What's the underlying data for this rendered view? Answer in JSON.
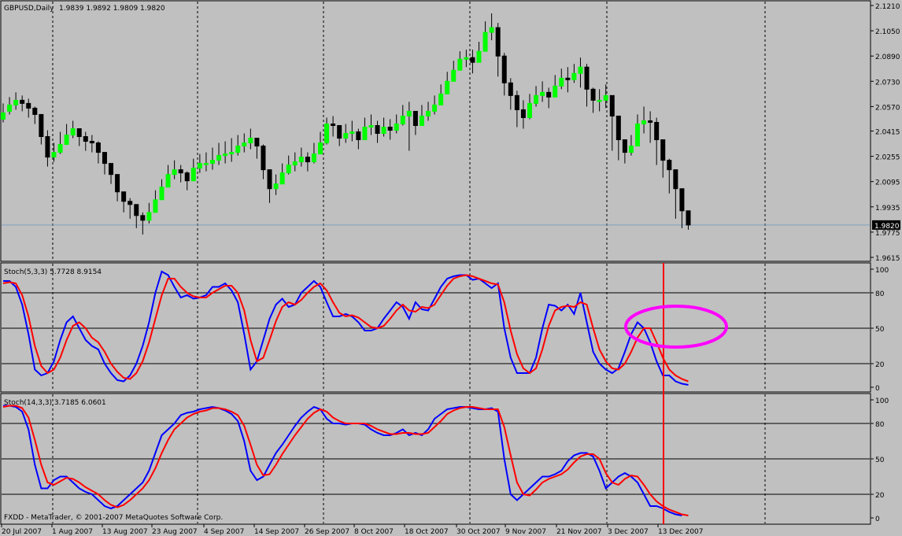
{
  "colors": {
    "background": "#c0c0c0",
    "bull_candle": "#00ff00",
    "bear_candle": "#000000",
    "stoch_main": "#0000ff",
    "stoch_signal": "#ff0000",
    "marker_line": "#ff0000",
    "highlight_ellipse": "#ff00ff",
    "price_line": "#7f9fbf"
  },
  "header": {
    "title": "GBPUSD,Daily",
    "ohlc": "1.9839 1.9892 1.9809 1.9820",
    "stoch1": "Stoch(5,3,3) 5.7728 8.9154",
    "stoch2": "Stoch(14,3,3) 3.7185 6.0601",
    "footer": "FXDD - MetaTrader, © 2001-2007 MetaQuotes Software Corp."
  },
  "chart_data": [
    {
      "type": "candlestick",
      "title": "GBPUSD,Daily",
      "ylim": [
        1.9615,
        2.121
      ],
      "y_ticks": [
        "2.1210",
        "2.1050",
        "2.0890",
        "2.0730",
        "2.0570",
        "2.0415",
        "2.0255",
        "2.0095",
        "1.9935",
        "1.9775",
        "1.9615"
      ],
      "current_price": "1.9820",
      "x_ticks": [
        "20 Jul 2007",
        "1 Aug 2007",
        "13 Aug 2007",
        "23 Aug 2007",
        "4 Sep 2007",
        "14 Sep 2007",
        "26 Sep 2007",
        "8 Oct 2007",
        "18 Oct 2007",
        "30 Oct 2007",
        "9 Nov 2007",
        "21 Nov 2007",
        "3 Dec 2007",
        "13 Dec 2007"
      ],
      "close": [
        2.053,
        2.058,
        2.061,
        2.059,
        2.056,
        2.052,
        2.038,
        2.025,
        2.028,
        2.033,
        2.039,
        2.043,
        2.038,
        2.035,
        2.034,
        2.028,
        2.021,
        2.014,
        2.003,
        1.997,
        1.995,
        1.988,
        1.985,
        1.99,
        1.998,
        2.006,
        2.014,
        2.017,
        2.015,
        2.01,
        2.018,
        2.021,
        2.021,
        2.023,
        2.026,
        2.027,
        2.028,
        2.032,
        2.034,
        2.037,
        2.032,
        2.017,
        2.005,
        2.008,
        2.015,
        2.02,
        2.022,
        2.025,
        2.022,
        2.027,
        2.034,
        2.046,
        2.045,
        2.037,
        2.04,
        2.041,
        2.036,
        2.044,
        2.045,
        2.04,
        2.044,
        2.042,
        2.046,
        2.051,
        2.054,
        2.045,
        2.051,
        2.054,
        2.058,
        2.065,
        2.073,
        2.08,
        2.087,
        2.088,
        2.085,
        2.092,
        2.104,
        2.107,
        2.089,
        2.072,
        2.064,
        2.055,
        2.05,
        2.059,
        2.064,
        2.066,
        2.063,
        2.07,
        2.075,
        2.074,
        2.078,
        2.082,
        2.068,
        2.061,
        2.061,
        2.064,
        2.051,
        2.036,
        2.028,
        2.032,
        2.046,
        2.048,
        2.047,
        2.036,
        2.023,
        2.017,
        2.005,
        1.991,
        1.982
      ],
      "high": [
        2.059,
        2.063,
        2.066,
        2.064,
        2.062,
        2.057,
        2.052,
        2.042,
        2.034,
        2.041,
        2.046,
        2.048,
        2.043,
        2.041,
        2.039,
        2.035,
        2.028,
        2.021,
        2.01,
        2.002,
        1.999,
        1.994,
        1.99,
        1.996,
        2.004,
        2.011,
        2.02,
        2.023,
        2.02,
        2.016,
        2.024,
        2.027,
        2.028,
        2.031,
        2.034,
        2.035,
        2.037,
        2.039,
        2.04,
        2.043,
        2.037,
        2.033,
        2.015,
        2.014,
        2.021,
        2.026,
        2.028,
        2.031,
        2.028,
        2.034,
        2.041,
        2.05,
        2.051,
        2.045,
        2.046,
        2.048,
        2.043,
        2.05,
        2.052,
        2.048,
        2.05,
        2.049,
        2.052,
        2.058,
        2.06,
        2.052,
        2.058,
        2.06,
        2.064,
        2.071,
        2.079,
        2.086,
        2.092,
        2.093,
        2.093,
        2.098,
        2.111,
        2.116,
        2.11,
        2.091,
        2.075,
        2.067,
        2.061,
        2.065,
        2.07,
        2.073,
        2.069,
        2.077,
        2.081,
        2.082,
        2.084,
        2.088,
        2.084,
        2.069,
        2.068,
        2.071,
        2.064,
        2.05,
        2.035,
        2.039,
        2.052,
        2.057,
        2.054,
        2.05,
        2.03,
        2.024,
        2.017,
        1.998,
        1.989
      ],
      "low": [
        2.047,
        2.052,
        2.055,
        2.054,
        2.05,
        2.046,
        2.033,
        2.019,
        2.022,
        2.027,
        2.033,
        2.037,
        2.032,
        2.029,
        2.028,
        2.021,
        2.014,
        2.008,
        1.997,
        1.99,
        1.986,
        1.98,
        1.976,
        1.983,
        1.991,
        1.999,
        2.007,
        2.011,
        2.009,
        2.004,
        2.011,
        2.015,
        2.016,
        2.017,
        2.02,
        2.021,
        2.022,
        2.026,
        2.028,
        2.03,
        2.024,
        2.011,
        1.996,
        2.001,
        2.009,
        2.014,
        2.016,
        2.019,
        2.016,
        2.021,
        2.027,
        2.033,
        2.038,
        2.032,
        2.034,
        2.035,
        2.03,
        2.037,
        2.039,
        2.034,
        2.038,
        2.036,
        2.04,
        2.045,
        2.029,
        2.039,
        2.045,
        2.048,
        2.052,
        2.058,
        2.066,
        2.073,
        2.08,
        2.082,
        2.078,
        2.085,
        2.097,
        2.099,
        2.076,
        2.064,
        2.055,
        2.044,
        2.043,
        2.049,
        2.057,
        2.06,
        2.056,
        2.063,
        2.068,
        2.066,
        2.072,
        2.069,
        2.057,
        2.053,
        2.054,
        2.056,
        2.029,
        2.023,
        2.021,
        2.026,
        2.039,
        2.04,
        2.034,
        2.02,
        2.012,
        2.002,
        1.986,
        1.98,
        1.979
      ],
      "open": [
        2.049,
        2.054,
        2.058,
        2.061,
        2.059,
        2.056,
        2.052,
        2.038,
        2.025,
        2.028,
        2.033,
        2.039,
        2.043,
        2.038,
        2.035,
        2.034,
        2.028,
        2.021,
        2.014,
        2.003,
        1.997,
        1.995,
        1.988,
        1.985,
        1.99,
        1.998,
        2.006,
        2.014,
        2.017,
        2.015,
        2.01,
        2.018,
        2.021,
        2.021,
        2.023,
        2.026,
        2.027,
        2.028,
        2.032,
        2.034,
        2.037,
        2.032,
        2.017,
        2.005,
        2.008,
        2.015,
        2.02,
        2.022,
        2.025,
        2.022,
        2.027,
        2.034,
        2.046,
        2.045,
        2.037,
        2.04,
        2.041,
        2.036,
        2.044,
        2.045,
        2.04,
        2.044,
        2.042,
        2.046,
        2.051,
        2.054,
        2.045,
        2.051,
        2.054,
        2.058,
        2.065,
        2.073,
        2.08,
        2.087,
        2.088,
        2.085,
        2.092,
        2.104,
        2.107,
        2.089,
        2.072,
        2.064,
        2.055,
        2.05,
        2.059,
        2.064,
        2.066,
        2.063,
        2.07,
        2.075,
        2.074,
        2.078,
        2.082,
        2.068,
        2.061,
        2.061,
        2.064,
        2.051,
        2.036,
        2.028,
        2.032,
        2.046,
        2.048,
        2.047,
        2.036,
        2.023,
        2.017,
        2.005,
        1.991
      ]
    },
    {
      "type": "line",
      "title": "Stoch(5,3,3) 5.7728 8.9154",
      "ylim": [
        0,
        100
      ],
      "y_ticks": [
        "100",
        "80",
        "50",
        "20",
        "0"
      ],
      "series": [
        {
          "name": "main",
          "values": [
            90,
            90,
            85,
            70,
            45,
            15,
            10,
            12,
            22,
            40,
            55,
            60,
            50,
            40,
            35,
            32,
            20,
            12,
            6,
            5,
            10,
            20,
            35,
            55,
            80,
            98,
            95,
            85,
            76,
            78,
            75,
            76,
            78,
            85,
            85,
            88,
            82,
            72,
            45,
            15,
            22,
            40,
            58,
            70,
            75,
            68,
            70,
            80,
            85,
            90,
            85,
            72,
            60,
            60,
            62,
            60,
            55,
            48,
            48,
            50,
            58,
            65,
            72,
            68,
            58,
            72,
            66,
            65,
            75,
            85,
            92,
            94,
            95,
            95,
            91,
            92,
            88,
            84,
            88,
            50,
            25,
            12,
            12,
            12,
            25,
            50,
            70,
            69,
            65,
            70,
            62,
            80,
            55,
            30,
            20,
            15,
            12,
            16,
            30,
            45,
            55,
            50,
            38,
            22,
            10,
            10,
            5,
            3,
            2
          ]
        },
        {
          "name": "signal",
          "values": [
            88,
            89,
            88,
            78,
            60,
            35,
            18,
            12,
            15,
            25,
            40,
            52,
            55,
            50,
            42,
            38,
            30,
            20,
            13,
            8,
            7,
            12,
            22,
            38,
            58,
            78,
            92,
            92,
            85,
            80,
            77,
            76,
            76,
            80,
            83,
            86,
            86,
            80,
            65,
            40,
            22,
            25,
            40,
            56,
            68,
            72,
            70,
            74,
            80,
            85,
            88,
            82,
            72,
            63,
            60,
            61,
            59,
            55,
            51,
            50,
            52,
            58,
            65,
            70,
            65,
            64,
            68,
            67,
            70,
            78,
            86,
            92,
            94,
            95,
            94,
            92,
            90,
            88,
            87,
            72,
            48,
            28,
            16,
            12,
            16,
            32,
            52,
            65,
            68,
            69,
            68,
            72,
            70,
            50,
            32,
            22,
            16,
            15,
            20,
            30,
            42,
            50,
            50,
            38,
            25,
            15,
            10,
            7,
            5
          ]
        }
      ]
    },
    {
      "type": "line",
      "title": "Stoch(14,3,3) 3.7185 6.0601",
      "ylim": [
        0,
        100
      ],
      "y_ticks": [
        "100",
        "80",
        "50",
        "20",
        "0"
      ],
      "series": [
        {
          "name": "main",
          "values": [
            95,
            95,
            94,
            90,
            75,
            45,
            25,
            25,
            32,
            35,
            35,
            30,
            25,
            22,
            20,
            15,
            10,
            8,
            10,
            15,
            20,
            25,
            30,
            40,
            55,
            70,
            75,
            80,
            87,
            89,
            90,
            92,
            93,
            94,
            93,
            91,
            88,
            82,
            65,
            40,
            32,
            35,
            45,
            55,
            62,
            70,
            78,
            85,
            90,
            94,
            92,
            84,
            80,
            80,
            79,
            80,
            80,
            79,
            75,
            72,
            70,
            70,
            72,
            75,
            70,
            72,
            70,
            75,
            84,
            88,
            92,
            93,
            94,
            94,
            93,
            92,
            92,
            93,
            90,
            50,
            20,
            15,
            20,
            25,
            30,
            35,
            35,
            37,
            40,
            48,
            53,
            55,
            55,
            52,
            40,
            25,
            30,
            35,
            38,
            35,
            30,
            20,
            10,
            10,
            8,
            5,
            3,
            2
          ]
        },
        {
          "name": "signal",
          "values": [
            94,
            95,
            95,
            93,
            85,
            66,
            45,
            30,
            28,
            31,
            34,
            33,
            30,
            26,
            23,
            20,
            15,
            11,
            9,
            11,
            15,
            20,
            25,
            32,
            42,
            55,
            66,
            75,
            80,
            85,
            88,
            90,
            91,
            93,
            93,
            92,
            90,
            87,
            78,
            62,
            45,
            36,
            37,
            45,
            54,
            62,
            70,
            77,
            84,
            89,
            92,
            90,
            85,
            82,
            80,
            80,
            80,
            80,
            78,
            75,
            73,
            71,
            71,
            72,
            72,
            71,
            71,
            72,
            77,
            82,
            88,
            91,
            93,
            94,
            94,
            93,
            92,
            92,
            92,
            77,
            53,
            30,
            20,
            19,
            24,
            30,
            33,
            35,
            37,
            41,
            47,
            52,
            54,
            54,
            50,
            38,
            30,
            28,
            33,
            36,
            35,
            28,
            20,
            14,
            10,
            7,
            5,
            3,
            2
          ]
        }
      ]
    }
  ]
}
